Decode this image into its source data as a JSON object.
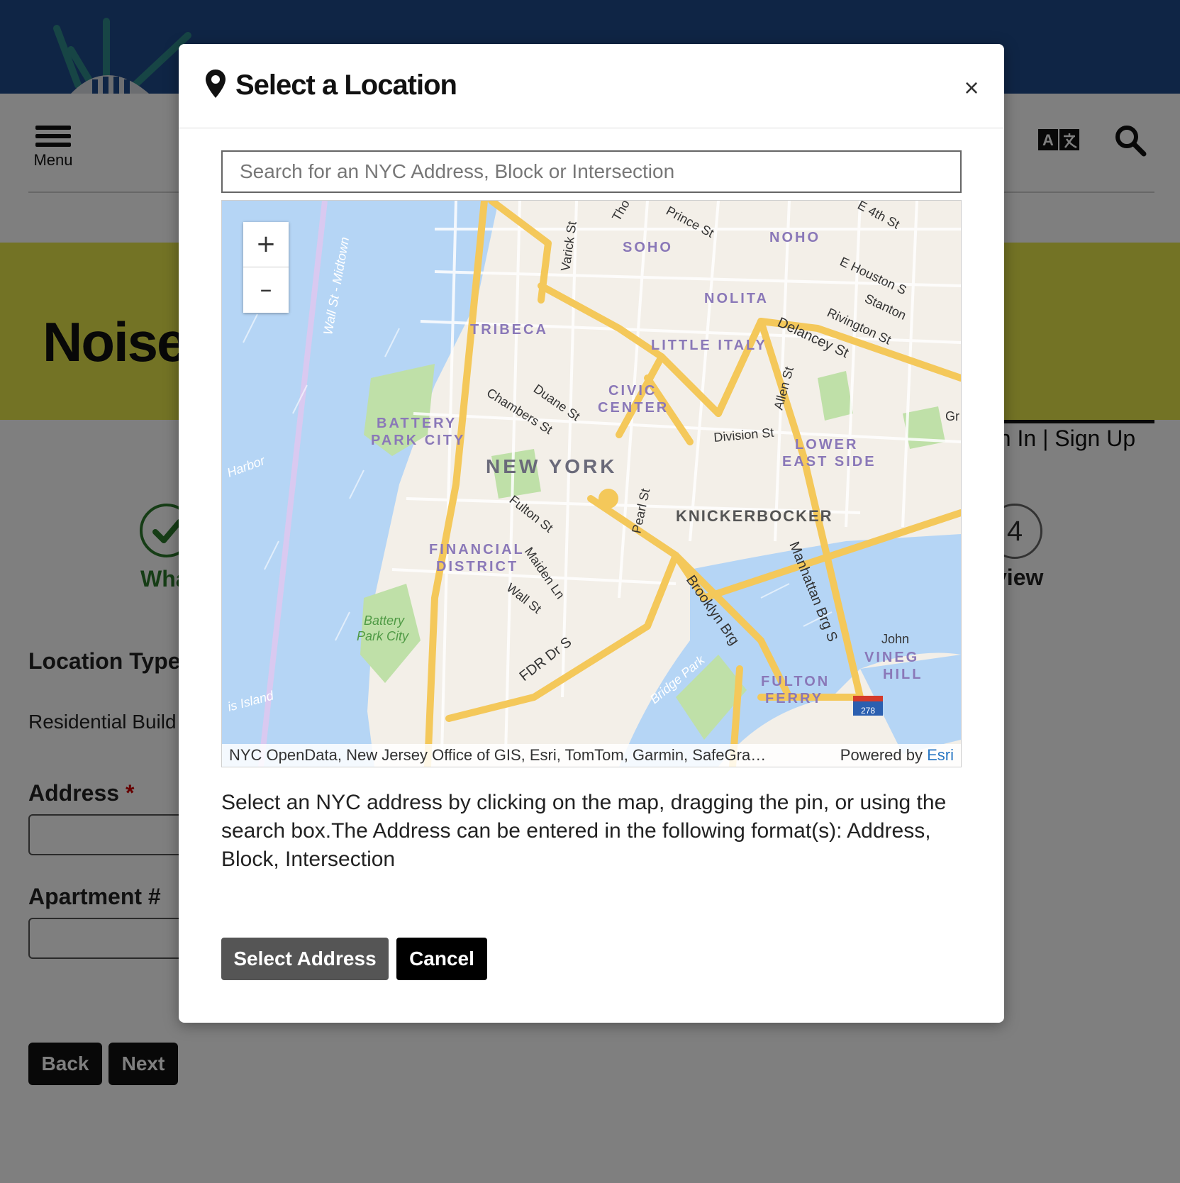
{
  "page": {
    "menu_label": "Menu",
    "hero_title": "Noise",
    "signin_text": "gn In",
    "signup_text": "Sign Up",
    "signin_separator": "|",
    "step1_label": "Wha",
    "step4_number": "4",
    "step4_label": "view",
    "location_type_label": "Location Type",
    "location_type_value": "Residential Build",
    "address_label": "Address",
    "required_mark": "*",
    "apartment_label": "Apartment #",
    "back_label": "Back",
    "next_label": "Next"
  },
  "modal": {
    "title": "Select a Location",
    "close_symbol": "×",
    "search_placeholder": "Search for an NYC Address, Block or Intersection",
    "zoom_in": "+",
    "zoom_out": "–",
    "attribution": "NYC OpenData, New Jersey Office of GIS, Esri, TomTom, Garmin, SafeGra…",
    "powered_by": "Powered by",
    "esri": "Esri",
    "instructions": "Select an NYC address by clicking on the map, dragging the pin, or using the search box.The Address can be entered in the following format(s): Address, Block, Intersection",
    "select_button": "Select Address",
    "cancel_button": "Cancel"
  },
  "map_labels": {
    "soho": "SOHO",
    "noho": "NOHO",
    "nolita": "NOLITA",
    "tribeca": "TRIBECA",
    "little_italy": "LITTLE ITALY",
    "civic": "CIVIC",
    "center": "CENTER",
    "battery": "BATTERY",
    "park_city": "PARK CITY",
    "new_york": "NEW YORK",
    "lower": "LOWER",
    "east_side": "EAST SIDE",
    "knickerbocker": "KNICKERBOCKER",
    "financial": "FINANCIAL",
    "district": "DISTRICT",
    "fulton": "FULTON",
    "ferry": "FERRY",
    "vineg": "VINEG",
    "hill": "HILL",
    "battery_park_1": "Battery",
    "battery_park_2": "Park City",
    "harbor": "Harbor",
    "island": "is Island",
    "bridge_park": "Bridge Park",
    "john": "John",
    "gr": "Gr",
    "tho": "Tho",
    "varick": "Varick St",
    "prince": "Prince St",
    "e4th": "E 4th St",
    "houston": "E Houston S",
    "stanton": "Stanton",
    "rivington": "Rivington St",
    "delancey": "Delancey St",
    "allen": "Allen St",
    "division": "Division St",
    "duane": "Duane St",
    "chambers": "Chambers St",
    "fulton_st": "Fulton St",
    "pearl": "Pearl St",
    "maiden": "Maiden Ln",
    "wall": "Wall St",
    "fdr": "FDR Dr S",
    "brooklyn": "Brooklyn Brg",
    "manhattan": "Manhattan Brg S",
    "westside": "Wall St - Midtown",
    "highway_shield": "278"
  },
  "colors": {
    "top_band": "#1e4a8a",
    "hero": "#e7e64a",
    "water": "#b5d5f5",
    "major_road": "#f4c85a",
    "district_label": "#8a78b8",
    "step_complete": "#2c7a2c",
    "esri_link": "#2b78c4"
  }
}
